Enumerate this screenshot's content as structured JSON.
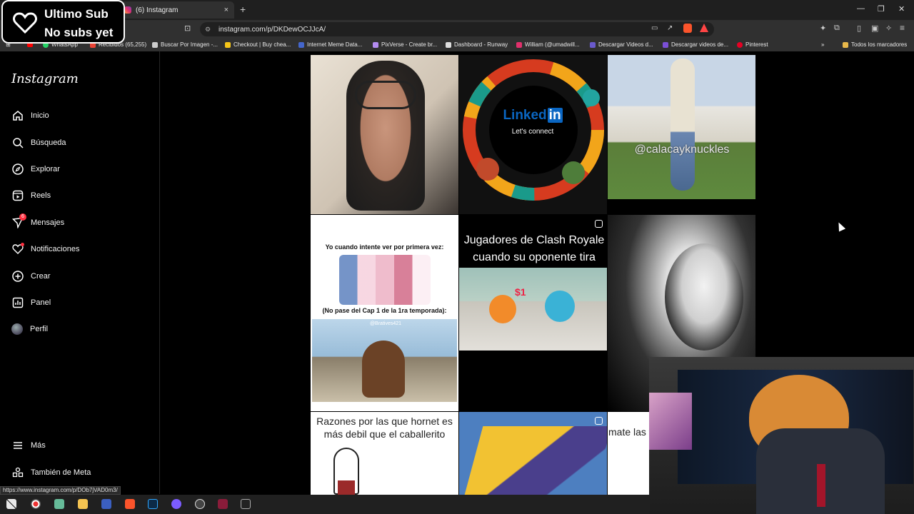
{
  "overlay": {
    "line1": "Ultimo Sub",
    "line2": "No subs yet"
  },
  "browser": {
    "tab_title": "(6) Instagram",
    "url": "instagram.com/p/DKDewOCJJcA/",
    "new_tab": "+",
    "close_tab": "×",
    "status_url": "https://www.instagram.com/p/DOb7jVAD0m3/",
    "bookmarks": [
      "WhatsApp",
      "Recibidos (65,255)",
      "Buscar Por Imagen -...",
      "Checkout | Buy chea...",
      "Internet Meme Data...",
      "PixVerse - Create br...",
      "Dashboard - Runway",
      "William (@umadwill...",
      "Descargar Videos d...",
      "Descargar videos de...",
      "Pinterest",
      "Todos los marcadores"
    ]
  },
  "sidebar": {
    "logo": "Instagram",
    "items": [
      {
        "label": "Inicio",
        "icon": "home-icon"
      },
      {
        "label": "Búsqueda",
        "icon": "search-icon"
      },
      {
        "label": "Explorar",
        "icon": "compass-icon"
      },
      {
        "label": "Reels",
        "icon": "reels-icon"
      },
      {
        "label": "Mensajes",
        "icon": "messenger-icon",
        "badge": "6"
      },
      {
        "label": "Notificaciones",
        "icon": "heart-icon"
      },
      {
        "label": "Crear",
        "icon": "plus-square-icon"
      },
      {
        "label": "Panel",
        "icon": "chart-icon"
      },
      {
        "label": "Perfil",
        "icon": "avatar"
      }
    ],
    "more": "Más",
    "meta": "También de Meta"
  },
  "grid": {
    "linkedin_title": "Linked",
    "linkedin_in": "in",
    "linkedin_sub": "Let's connect",
    "watermark": "@calacayknuckles",
    "meme1_top": "Yo cuando intente ver por primera vez:",
    "meme1_mid": "(No pase del Cap 1 de la 1ra temporada):",
    "meme1_tag": "@Bratives421",
    "meme2": "Jugadores de Clash Royale cuando su oponente tira una carta",
    "meme2_price": "$1",
    "meme3": "Razones por las que hornet es más debil que el caballerito",
    "meme4": "mate las foto"
  }
}
